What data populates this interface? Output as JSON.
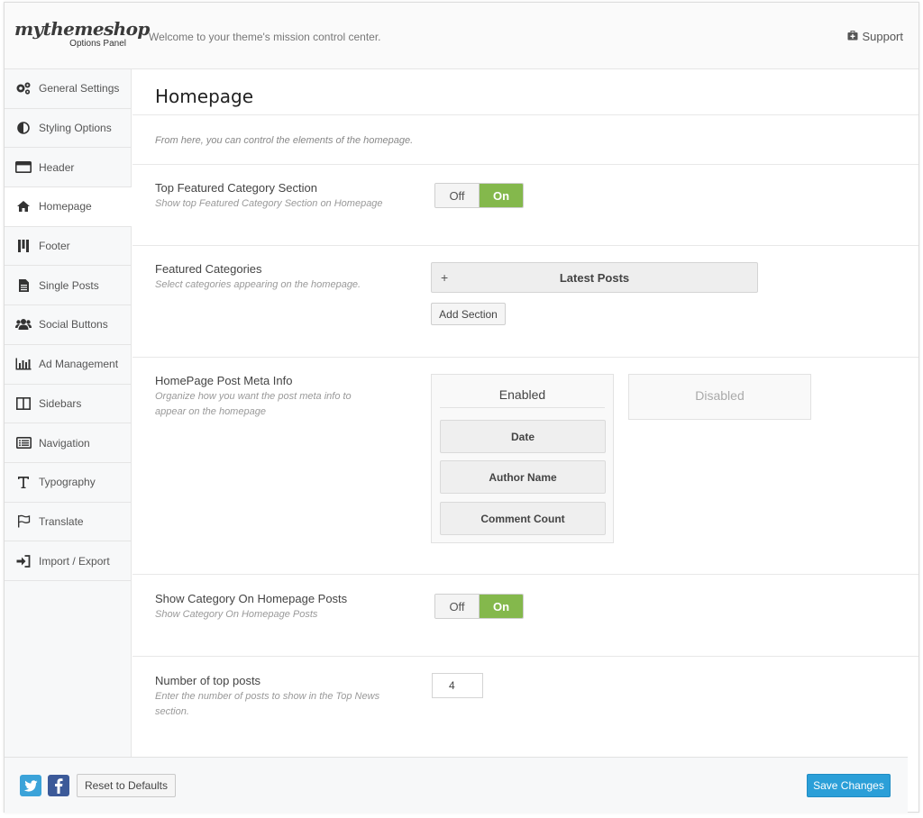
{
  "header": {
    "logo_text": "mythemeshop",
    "logo_sub": "Options Panel",
    "welcome": "Welcome to your theme's mission control center.",
    "support_label": "Support"
  },
  "sidebar": {
    "items": [
      {
        "label": "General Settings",
        "icon": "gears-icon"
      },
      {
        "label": "Styling Options",
        "icon": "contrast-icon"
      },
      {
        "label": "Header",
        "icon": "header-icon"
      },
      {
        "label": "Homepage",
        "icon": "home-icon",
        "active": true
      },
      {
        "label": "Footer",
        "icon": "footer-icon"
      },
      {
        "label": "Single Posts",
        "icon": "document-icon"
      },
      {
        "label": "Social Buttons",
        "icon": "users-icon"
      },
      {
        "label": "Ad Management",
        "icon": "bar-chart-icon"
      },
      {
        "label": "Sidebars",
        "icon": "columns-icon"
      },
      {
        "label": "Navigation",
        "icon": "list-icon"
      },
      {
        "label": "Typography",
        "icon": "text-icon"
      },
      {
        "label": "Translate",
        "icon": "flag-icon"
      },
      {
        "label": "Import / Export",
        "icon": "sign-in-icon"
      }
    ]
  },
  "main": {
    "title": "Homepage",
    "description": "From here, you can control the elements of the homepage.",
    "options": {
      "top_featured": {
        "label": "Top Featured Category Section",
        "help": "Show top Featured Category Section on Homepage",
        "off": "Off",
        "on": "On",
        "value": "On"
      },
      "featured_categories": {
        "label": "Featured Categories",
        "help": "Select categories appearing on the homepage.",
        "section_plus": "+",
        "section_label": "Latest Posts",
        "add_section": "Add Section"
      },
      "post_meta": {
        "label": "HomePage Post Meta Info",
        "help": "Organize how you want the post meta info to appear on the homepage",
        "enabled_title": "Enabled",
        "disabled_title": "Disabled",
        "enabled_items": [
          "Date",
          "Author Name",
          "Comment Count"
        ]
      },
      "show_category": {
        "label": "Show Category On Homepage Posts",
        "help": "Show Category On Homepage Posts",
        "off": "Off",
        "on": "On",
        "value": "On"
      },
      "top_posts": {
        "label": "Number of top posts",
        "help": "Enter the number of posts to show in the Top News section.",
        "value": "4"
      }
    }
  },
  "footer": {
    "reset_label": "Reset to Defaults",
    "save_label": "Save Changes"
  },
  "colors": {
    "accent": "#2b9fd8",
    "toggle_on": "#84b84c",
    "twitter": "#3ba3d9",
    "facebook": "#3c5a99"
  }
}
